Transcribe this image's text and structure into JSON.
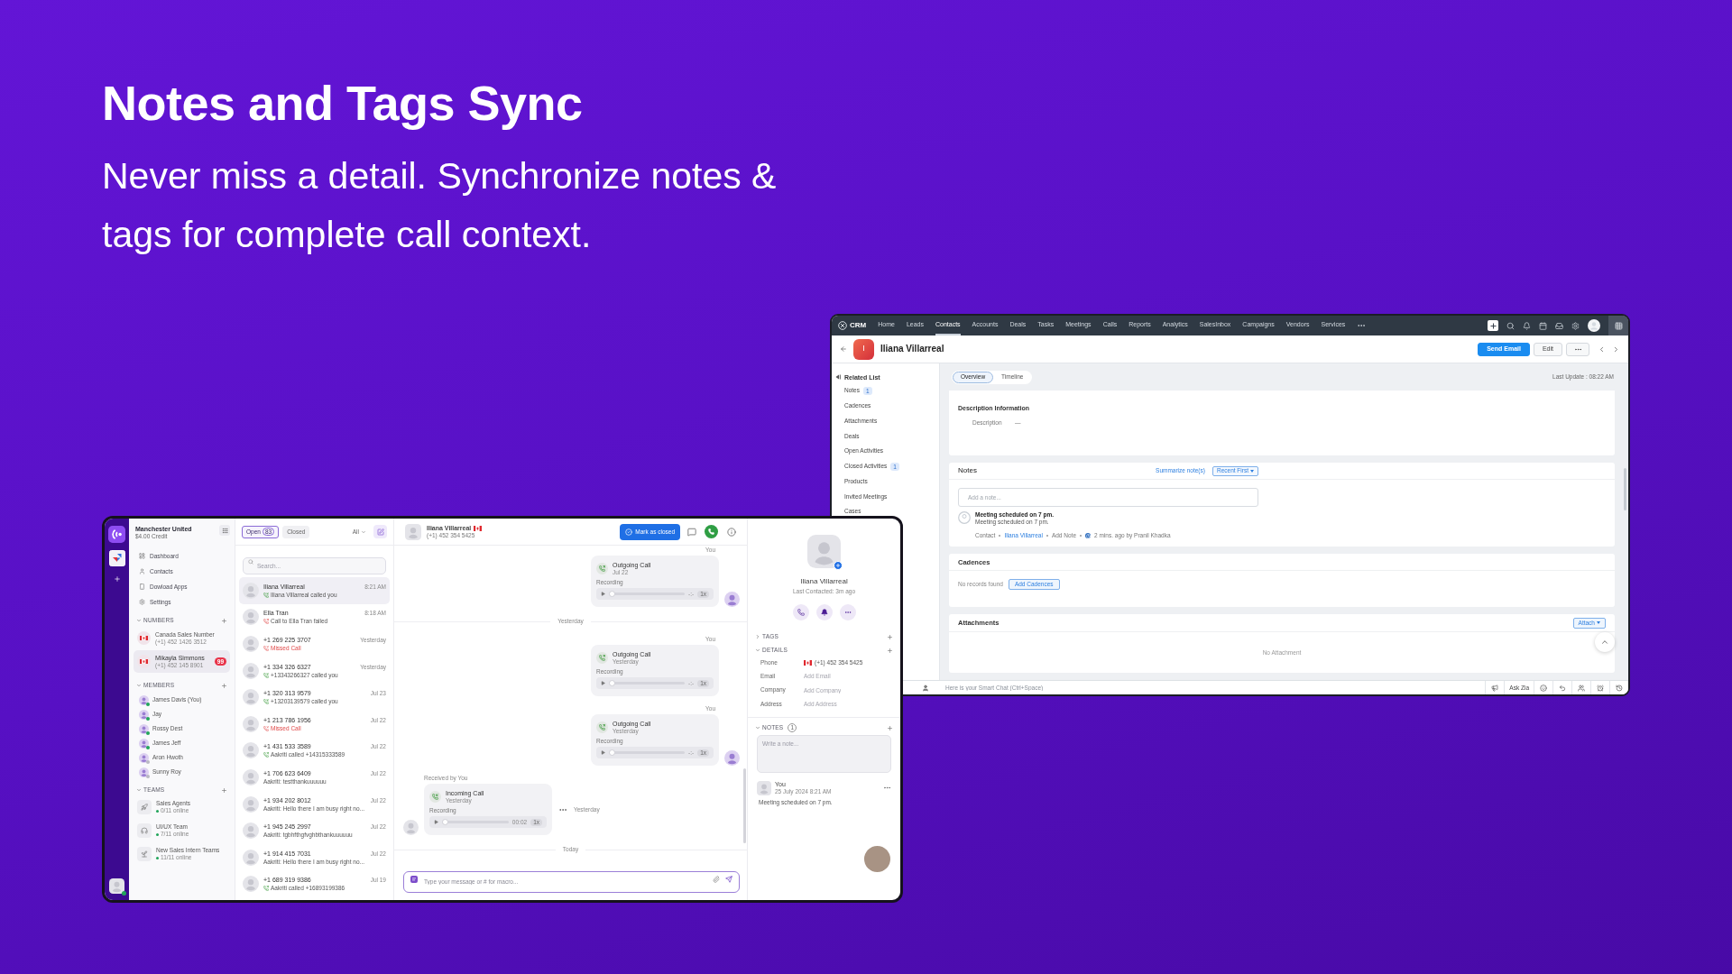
{
  "hero": {
    "title": "Notes and Tags Sync",
    "subtitle": "Never miss a detail. Synchronize notes & tags for complete call context."
  },
  "phone_app": {
    "sidebar": {
      "account": "Manchester United",
      "credit": "$4.00 Credit",
      "nav": [
        "Dashboard",
        "Contacts",
        "Dowload Apps",
        "Settings"
      ],
      "numbers": {
        "title": "NUMBERS",
        "expanded": true,
        "items": [
          {
            "name": "Canada Sales Number",
            "phone": "(+1) 452 1426 3512",
            "selected": false
          },
          {
            "name": "Mikayla Simmons",
            "phone": "(+1) 452 145 8901",
            "badge": "99",
            "selected": true
          }
        ]
      },
      "members": {
        "title": "MEMBERS",
        "expanded": true,
        "items": [
          {
            "name": "James Davis (You)",
            "online": true
          },
          {
            "name": "Jay",
            "online": true
          },
          {
            "name": "Rossy Dest",
            "online": true
          },
          {
            "name": "James Jeff",
            "online": true
          },
          {
            "name": "Aron Hwoth",
            "online": false
          },
          {
            "name": "Sunny Roy",
            "online": false
          }
        ]
      },
      "teams": {
        "title": "TEAMS",
        "expanded": true,
        "items": [
          {
            "name": "Sales Agents",
            "status": "0/11 online"
          },
          {
            "name": "UI/UX Team",
            "status": "7/11 online"
          },
          {
            "name": "New Sales Intern Teams",
            "status": "11/11 online"
          }
        ]
      }
    },
    "conversations": {
      "tabs": [
        {
          "label": "Open",
          "count": "83",
          "selected": true
        },
        {
          "label": "Closed",
          "selected": false
        }
      ],
      "filter": "All",
      "search": {
        "placeholder": "Search..."
      },
      "rows": [
        {
          "name": "Iliana Villarreal",
          "time": "8:21 AM",
          "kind": "incoming",
          "preview": "Iliana Villarreal called you",
          "selected": true
        },
        {
          "name": "Ella Tran",
          "time": "8:18 AM",
          "kind": "failed",
          "preview": "Call to Ella Tran failed",
          "selected": false
        },
        {
          "name": "+1 269 225 3707",
          "time": "Yesterday",
          "kind": "missed",
          "preview": "Missed Call",
          "selected": false
        },
        {
          "name": "+1 334 326 6327",
          "time": "Yesterday",
          "kind": "incoming",
          "preview": "+13343266327 called you",
          "selected": false
        },
        {
          "name": "+1 320 313 9579",
          "time": "Jul 23",
          "kind": "incoming",
          "preview": "+13203139579 called you",
          "selected": false
        },
        {
          "name": "+1 213 786 1956",
          "time": "Jul 22",
          "kind": "missed",
          "preview": "Missed Call",
          "selected": false
        },
        {
          "name": "+1 431 533 3589",
          "time": "Jul 22",
          "kind": "outgoing",
          "preview": "Aakriti called +14315333589",
          "selected": false
        },
        {
          "name": "+1 706 623 6409",
          "time": "Jul 22",
          "kind": "message",
          "preview": "Aakriti: testthankuuuuuu",
          "selected": false
        },
        {
          "name": "+1 934 202 8012",
          "time": "Jul 22",
          "kind": "message",
          "preview": "Aakriti: Hello there I am busy right no...",
          "selected": false
        },
        {
          "name": "+1 945 245 2997",
          "time": "Jul 22",
          "kind": "message",
          "preview": "Aakriti: tgbhfthgfvghbthankuuuuuu",
          "selected": false
        },
        {
          "name": "+1 914 415 7031",
          "time": "Jul 22",
          "kind": "message",
          "preview": "Aakriti: Hello there I am busy right no...",
          "selected": false
        },
        {
          "name": "+1 689 319 9386",
          "time": "Jul 19",
          "kind": "outgoing",
          "preview": "Aakriti called +16893199386",
          "selected": false
        }
      ]
    },
    "chat": {
      "name": "Iliana Villarreal",
      "phone": "(+1) 452 354 5425",
      "close_button": "Mark as closed",
      "messages": [
        {
          "kind": "outgoing_call",
          "sender": "You",
          "title": "Outgoing Call",
          "date": "Jul 22",
          "recording": "Recording",
          "duration": "-:-",
          "speed": "1x",
          "level": 0,
          "avatar": true
        },
        {
          "kind": "separator",
          "label": "Yesterday"
        },
        {
          "kind": "outgoing_call",
          "sender": "You",
          "title": "Outgoing Call",
          "date": "Yesterday",
          "recording": "Recording",
          "duration": "-:-",
          "speed": "1x",
          "level": 0,
          "avatar": false
        },
        {
          "kind": "outgoing_call",
          "sender": "You",
          "title": "Outgoing Call",
          "date": "Yesterday",
          "recording": "Recording",
          "duration": "-:-",
          "speed": "1x",
          "level": 0,
          "avatar": true
        },
        {
          "kind": "incoming_call",
          "sender": "Received by You",
          "title": "Incoming Call",
          "date": "Yesterday",
          "recording": "Recording",
          "duration": "00:02",
          "speed": "1x",
          "level": 0,
          "avatar": true,
          "time": "Yesterday"
        },
        {
          "kind": "separator",
          "label": "Today"
        }
      ],
      "composer": {
        "placeholder": "Type your message or # for macro..."
      }
    },
    "contact_panel": {
      "name": "Iliana Villarreal",
      "last_contacted": "Last Contacted: 3m ago",
      "tags": {
        "title": "TAGS",
        "expanded": false
      },
      "details": {
        "title": "DETAILS",
        "expanded": true,
        "fields": [
          {
            "label": "Phone",
            "kind": "phone",
            "value": "(+1) 452 354 5425"
          },
          {
            "label": "Email",
            "kind": "text",
            "placeholder": "Add Email"
          },
          {
            "label": "Company",
            "kind": "text",
            "placeholder": "Add Company"
          },
          {
            "label": "Address",
            "kind": "text",
            "placeholder": "Add Address"
          }
        ]
      },
      "notes": {
        "title": "NOTES",
        "count": "1",
        "expanded": true,
        "input": {
          "placeholder": "Write a note..."
        },
        "items": [
          {
            "author": "You",
            "date": "25 July 2024 8:21 AM",
            "text": "Meeting scheduled on 7 pm."
          }
        ]
      }
    }
  },
  "crm": {
    "logo": "CRM",
    "nav": [
      {
        "label": "Home",
        "selected": false
      },
      {
        "label": "Leads",
        "selected": false
      },
      {
        "label": "Contacts",
        "selected": true
      },
      {
        "label": "Accounts",
        "selected": false
      },
      {
        "label": "Deals",
        "selected": false
      },
      {
        "label": "Tasks",
        "selected": false
      },
      {
        "label": "Meetings",
        "selected": false
      },
      {
        "label": "Calls",
        "selected": false
      },
      {
        "label": "Reports",
        "selected": false
      },
      {
        "label": "Analytics",
        "selected": false
      },
      {
        "label": "SalesInbox",
        "selected": false
      },
      {
        "label": "Campaigns",
        "selected": false
      },
      {
        "label": "Vendors",
        "selected": false
      },
      {
        "label": "Services",
        "selected": false
      }
    ],
    "record": {
      "initial": "I",
      "name": "Iliana Villarreal",
      "buttons": [
        {
          "label": "Send Email",
          "primary": true
        },
        {
          "label": "Edit",
          "primary": false
        }
      ]
    },
    "related_list": {
      "title": "Related List",
      "items": [
        {
          "label": "Notes",
          "count": "1"
        },
        {
          "label": "Cadences"
        },
        {
          "label": "Attachments"
        },
        {
          "label": "Deals"
        },
        {
          "label": "Open Activities"
        },
        {
          "label": "Closed Activities",
          "count": "1"
        },
        {
          "label": "Products"
        },
        {
          "label": "Invited Meetings"
        },
        {
          "label": "Cases"
        }
      ]
    },
    "tabs": [
      {
        "label": "Overview",
        "selected": true
      },
      {
        "label": "Timeline",
        "selected": false
      }
    ],
    "last_update": "Last Update : 08:22 AM",
    "description": {
      "title": "Description Information",
      "fields": [
        {
          "label": "Description",
          "value": "—"
        }
      ]
    },
    "notes": {
      "title": "Notes",
      "summarize": "Summarize note(s)",
      "sort": "Recent First",
      "input": {
        "placeholder": "Add a note..."
      },
      "items": [
        {
          "title": "Meeting scheduled on 7 pm.",
          "body": "Meeting scheduled on 7 pm.",
          "contact_label": "Contact",
          "contact": "Iliana Villarreal",
          "action": "Add Note",
          "meta": "2 mins. ago by Pranil Khadka"
        }
      ]
    },
    "cadences": {
      "title": "Cadences",
      "empty": "No records found",
      "button": "Add Cadences"
    },
    "attachments": {
      "title": "Attachments",
      "button": "Attach",
      "empty": "No Attachment"
    },
    "smart_chat": {
      "placeholder": "Here is your Smart Chat (Ctrl+Space)"
    },
    "footer_button": "Ask Zia"
  }
}
